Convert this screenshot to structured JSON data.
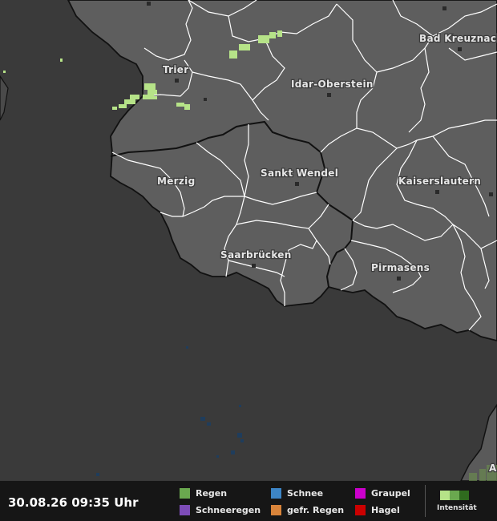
{
  "map": {
    "cities": [
      {
        "name": "Bad Kreuznach"
      },
      {
        "name": "Trier"
      },
      {
        "name": "Idar-Oberstein"
      },
      {
        "name": "Merzig"
      },
      {
        "name": "Sankt Wendel"
      },
      {
        "name": "Kaiserslautern"
      },
      {
        "name": "Saarbrücken"
      },
      {
        "name": "Pirmasens"
      },
      {
        "name": "A"
      }
    ]
  },
  "legend": {
    "timestamp": "30.08.26 09:35 Uhr",
    "items": [
      {
        "label": "Regen",
        "color": "#6aa84f"
      },
      {
        "label": "Schneeregen",
        "color": "#7d4cb8"
      },
      {
        "label": "Schnee",
        "color": "#3d85c6"
      },
      {
        "label": "gefr. Regen",
        "color": "#d9843a"
      },
      {
        "label": "Graupel",
        "color": "#cc00cc"
      },
      {
        "label": "Hagel",
        "color": "#cc0000"
      }
    ],
    "intensity_label": "Intensität",
    "intensity_colors": [
      "#b6e388",
      "#6aa84f",
      "#2f6b1e"
    ]
  },
  "colors": {
    "land": "#5e5e5e",
    "outside": "#3a3a3a",
    "border": "#111111",
    "district_line": "#ffffff",
    "rain_light": "#b6e388"
  }
}
